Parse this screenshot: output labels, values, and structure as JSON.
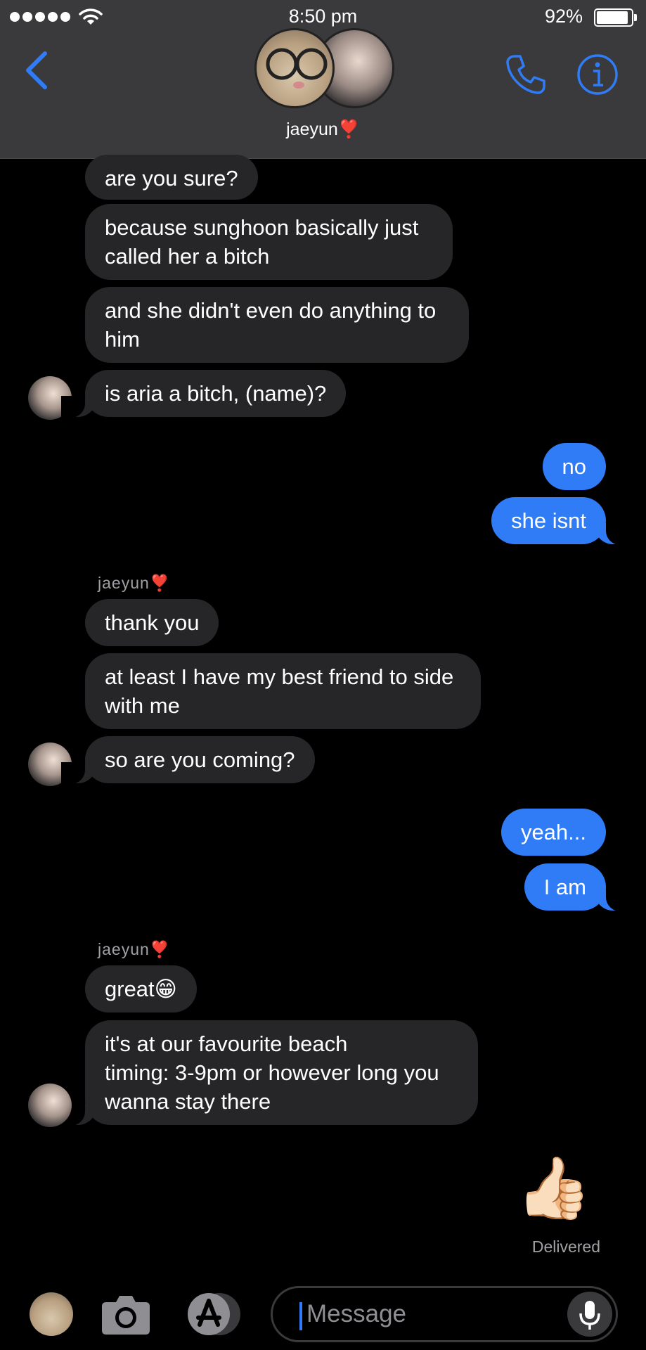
{
  "status_bar": {
    "time": "8:50 pm",
    "battery": "92%"
  },
  "header": {
    "contact_name": "jaeyun❣️"
  },
  "messages": [
    {
      "text": "are you sure?"
    },
    {
      "text": "because sunghoon basically just\ncalled her a bitch"
    },
    {
      "text": "and she didn't even do anything to\nhim"
    },
    {
      "text": "is aria a bitch, (name)?"
    },
    {
      "text": "no"
    },
    {
      "text": "she isnt"
    },
    {
      "sender": "jaeyun❣️"
    },
    {
      "text": "thank you"
    },
    {
      "text": "at least I have my best friend to side\nwith me"
    },
    {
      "text": "so are you coming?"
    },
    {
      "text": "yeah..."
    },
    {
      "text": "I am"
    },
    {
      "sender": "jaeyun❣️"
    },
    {
      "text": "great😁"
    },
    {
      "text": "it's at our favourite beach\ntiming: 3-9pm or however long you\nwanna stay there"
    },
    {
      "text": "👍🏻"
    }
  ],
  "delivered_label": "Delivered",
  "input": {
    "placeholder": "Message"
  },
  "colors": {
    "accent": "#2f7cf6",
    "incoming": "#262628",
    "header": "#3a3a3c"
  }
}
